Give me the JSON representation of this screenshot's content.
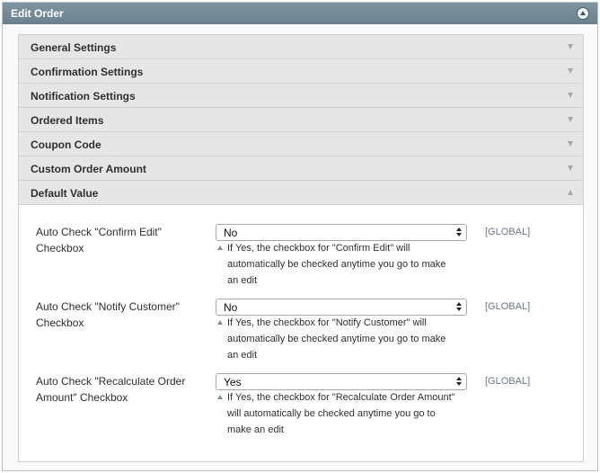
{
  "header": {
    "title": "Edit Order",
    "toggle_icon": "collapse-up-icon"
  },
  "sections": [
    {
      "label": "General Settings",
      "state": "collapsed"
    },
    {
      "label": "Confirmation Settings",
      "state": "collapsed"
    },
    {
      "label": "Notification Settings",
      "state": "collapsed"
    },
    {
      "label": "Ordered Items",
      "state": "collapsed"
    },
    {
      "label": "Coupon Code",
      "state": "collapsed"
    },
    {
      "label": "Custom Order Amount",
      "state": "collapsed"
    },
    {
      "label": "Default Value",
      "state": "expanded"
    }
  ],
  "fields": [
    {
      "label": "Auto Check \"Confirm Edit\" Checkbox",
      "value": "No",
      "scope": "[GLOBAL]",
      "note": "If Yes, the checkbox for \"Confirm Edit\" will automatically be checked anytime you go to make an edit"
    },
    {
      "label": "Auto Check \"Notify Customer\" Checkbox",
      "value": "No",
      "scope": "[GLOBAL]",
      "note": "If Yes, the checkbox for \"Notify Customer\" will automatically be checked anytime you go to make an edit"
    },
    {
      "label": "Auto Check \"Recalculate Order Amount\" Checkbox",
      "value": "Yes",
      "scope": "[GLOBAL]",
      "note": "If Yes, the checkbox for \"Recalculate Order Amount\" will automatically be checked anytime you go to make an edit"
    }
  ]
}
